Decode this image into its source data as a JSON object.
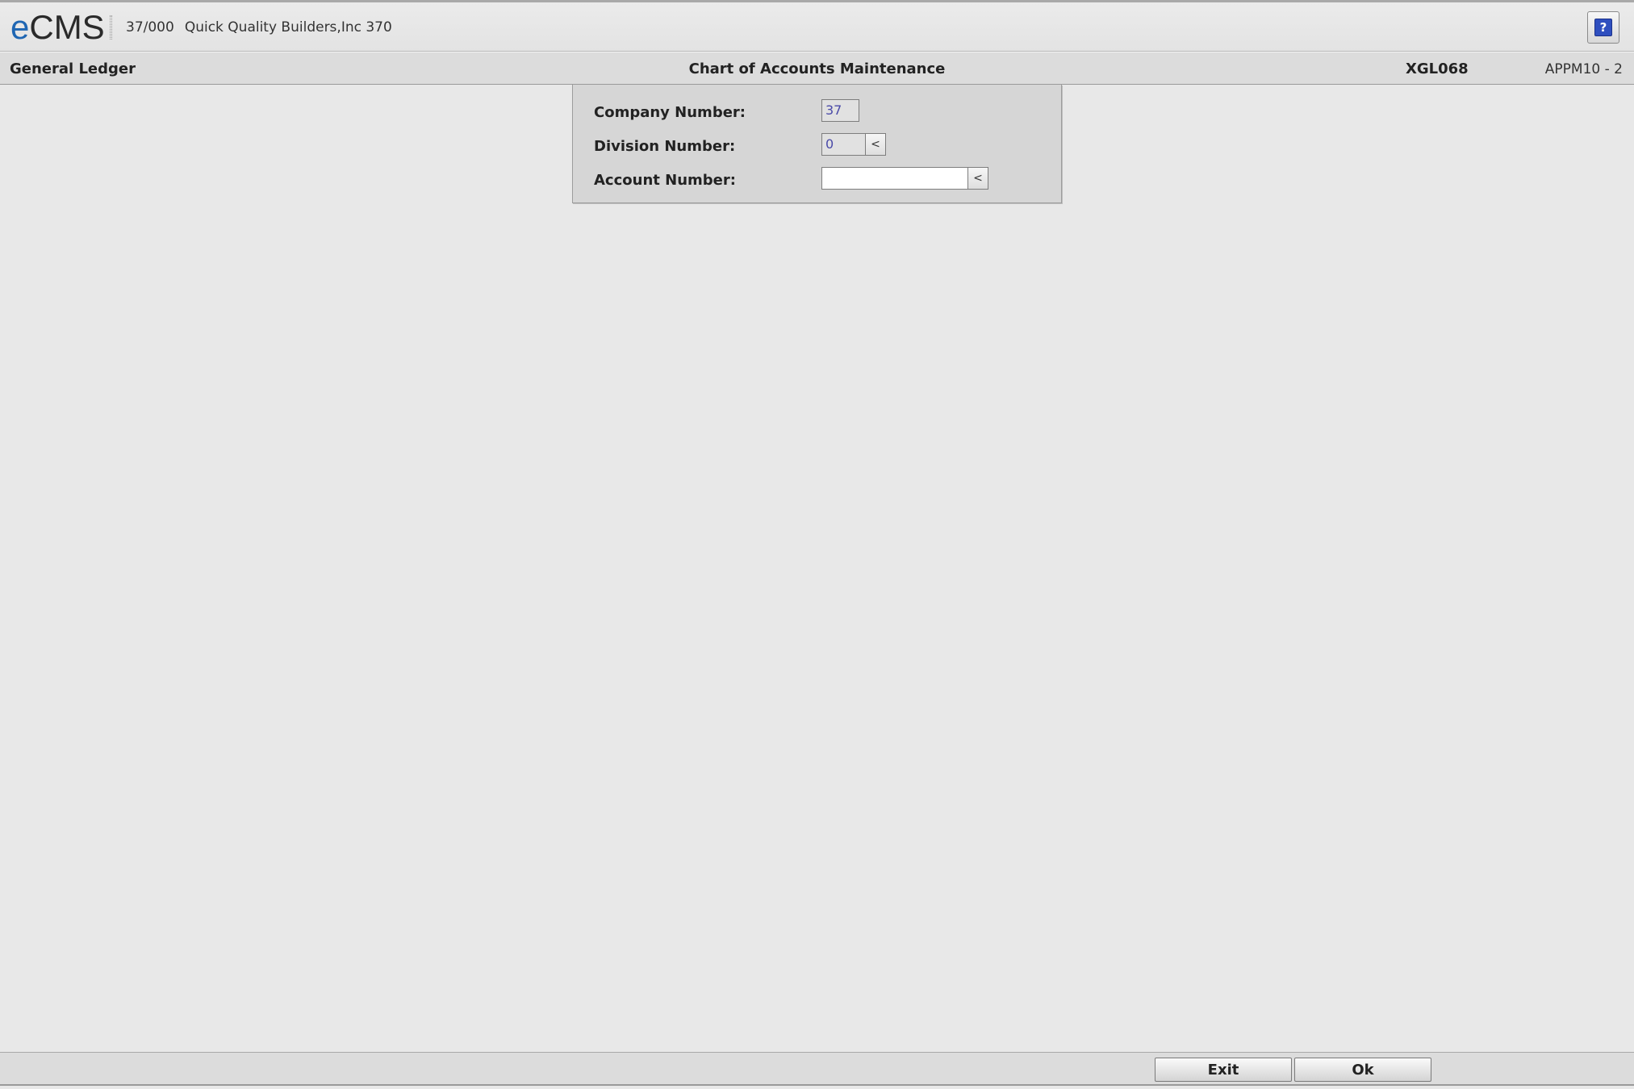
{
  "header": {
    "logo_e": "e",
    "logo_rest": "CMS",
    "company_code": "37/000",
    "company_name": "Quick Quality Builders,Inc 370",
    "help_label": "?"
  },
  "titlebar": {
    "module": "General Ledger",
    "screen_title": "Chart of Accounts Maintenance",
    "program": "XGL068",
    "screen_id": "APPM10 - 2"
  },
  "form": {
    "company": {
      "label": "Company Number:",
      "value": "37"
    },
    "division": {
      "label": "Division Number:",
      "value": "0",
      "lookup": "<"
    },
    "account": {
      "label": "Account Number:",
      "value": "",
      "lookup": "<"
    }
  },
  "footer": {
    "exit_label": "Exit",
    "ok_label": "Ok"
  },
  "colors": {
    "logo_accent": "#1f66b3",
    "field_text": "#4a4aa8",
    "help_icon": "#2f4fbf",
    "background": "#e8e8e8"
  },
  "icons": {
    "help": "help-icon",
    "lookup": "chevron-left-icon"
  }
}
